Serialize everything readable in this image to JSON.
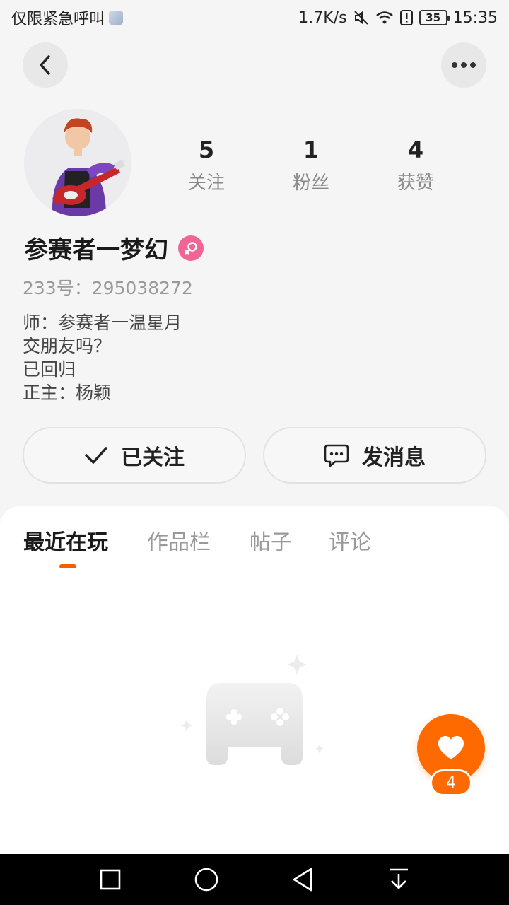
{
  "status_bar": {
    "carrier": "仅限紧急呼叫",
    "speed": "1.7K/s",
    "battery": "35",
    "time": "15:35"
  },
  "profile": {
    "name": "参赛者一梦幻",
    "uid": "233号：295038272",
    "bio": [
      "师：参赛者一温星月",
      "交朋友吗？",
      "已回归",
      "正主：杨颖"
    ],
    "stats": {
      "following_count": "5",
      "following_label": "关注",
      "fans_count": "1",
      "fans_label": "粉丝",
      "likes_count": "4",
      "likes_label": "获赞"
    }
  },
  "actions": {
    "follow_label": "已关注",
    "message_label": "发消息"
  },
  "tabs": [
    {
      "label": "最近在玩",
      "active": true
    },
    {
      "label": "作品栏",
      "active": false
    },
    {
      "label": "帖子",
      "active": false
    },
    {
      "label": "评论",
      "active": false
    }
  ],
  "like_fab": {
    "count": "4"
  },
  "colors": {
    "accent": "#ff6a00",
    "gender_badge": "#f06595"
  }
}
